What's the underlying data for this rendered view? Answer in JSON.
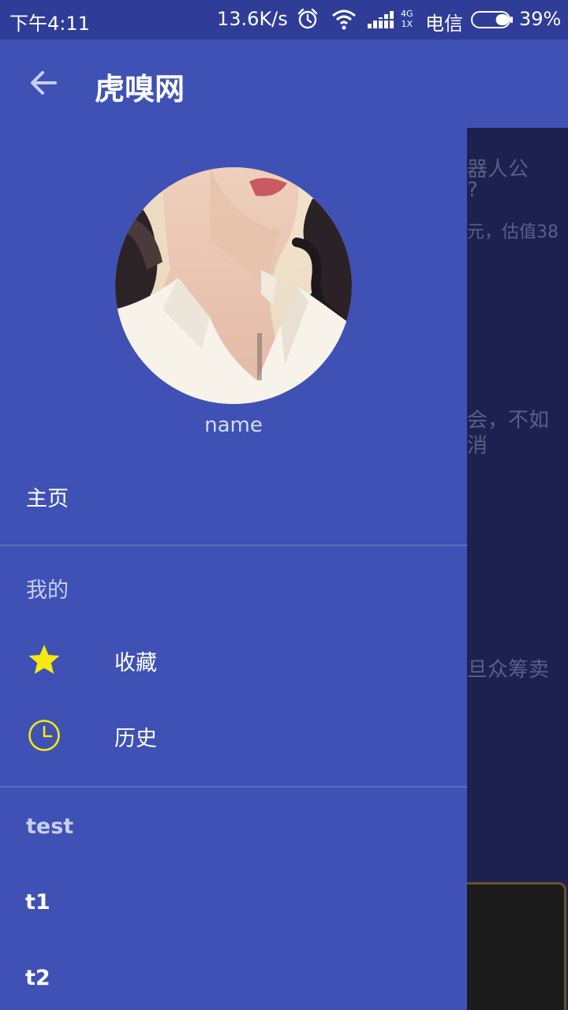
{
  "status_bar": {
    "time": "下午4:11",
    "speed": "13.6K/s",
    "net_top": "4G",
    "net_bottom": "1X",
    "carrier": "电信",
    "battery": "39%",
    "battery_level": 0.39
  },
  "app_bar": {
    "title": "虎嗅网",
    "back_icon": "arrow-back-icon"
  },
  "drawer": {
    "username": "name",
    "home_label": "主页",
    "section_mine": "我的",
    "favorites_label": "收藏",
    "favorites_icon": "star-icon",
    "history_label": "历史",
    "history_icon": "clock-icon",
    "section_test": "test",
    "sub_items": [
      "t1",
      "t2"
    ]
  },
  "background_list": {
    "item1_title_line1": "器人公",
    "item1_title_line2": "?",
    "item1_sub": "元，估值38",
    "item2_title_line1": "会，不如",
    "item2_title_line2": "消",
    "item3_title": "旦众筹卖"
  },
  "colors": {
    "primary": "#3f51b5",
    "status_bar": "#2f3d99",
    "accent_icon": "#f5e90f",
    "scrim": "#1c2150"
  }
}
